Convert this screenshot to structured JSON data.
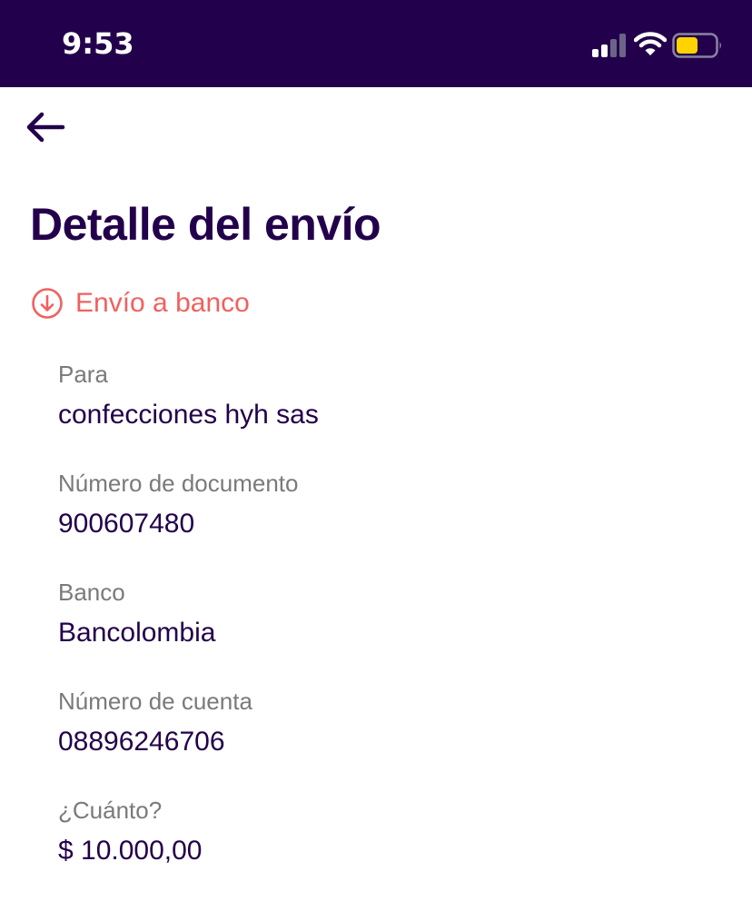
{
  "status_bar": {
    "time": "9:53",
    "background_color": "#23004c",
    "battery_color": "#ffd200",
    "icons": [
      "signal-icon",
      "wifi-icon",
      "battery-icon"
    ]
  },
  "header": {
    "back_icon": "arrow-left-icon",
    "title": "Detalle del envío"
  },
  "transfer": {
    "type_icon": "arrow-down-circle-icon",
    "type_label": "Envío a banco",
    "accent_color": "#f2605e"
  },
  "details": [
    {
      "label": "Para",
      "value": "confecciones hyh sas"
    },
    {
      "label": "Número de documento",
      "value": "900607480"
    },
    {
      "label": "Banco",
      "value": "Bancolombia"
    },
    {
      "label": "Número de cuenta",
      "value": "08896246706"
    },
    {
      "label": "¿Cuánto?",
      "value": "$ 10.000,00"
    }
  ]
}
